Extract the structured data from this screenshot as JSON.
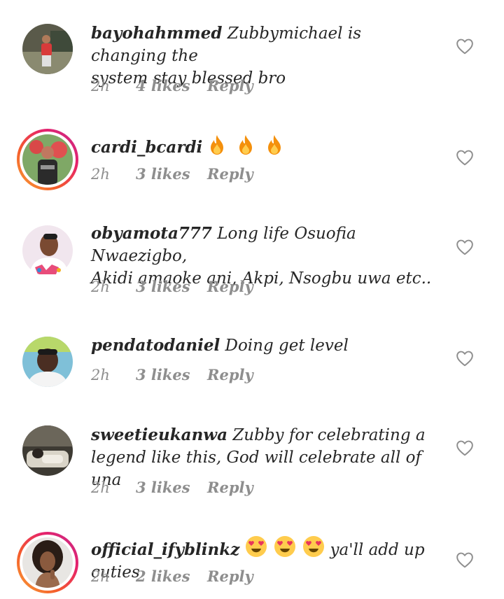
{
  "comments": [
    {
      "username": "bayohahmmed",
      "text": "Zubbymichael is changing the system stay blessed bro",
      "line1": "Zubbymichael is changing the",
      "line2": "system stay blessed bro",
      "time": "2h",
      "likes": "4 likes",
      "reply": "Reply",
      "story_ring": false
    },
    {
      "username": "cardi_bcardi",
      "text": "",
      "emoji": [
        "fire-emoji",
        "fire-emoji",
        "fire-emoji"
      ],
      "time": "2h",
      "likes": "3 likes",
      "reply": "Reply",
      "story_ring": true
    },
    {
      "username": "obyamota777",
      "text": "Long life Osuofia Nwaezigbo, Akidi amaoke ani, Akpi, Nsogbu uwa etc..",
      "line1": "Long life Osuofia Nwaezigbo,",
      "line2": "Akidi amaoke ani, Akpi, Nsogbu uwa etc..",
      "time": "2h",
      "likes": "3 likes",
      "reply": "Reply",
      "story_ring": false
    },
    {
      "username": "pendatodaniel",
      "text": "Doing get level",
      "time": "2h",
      "likes": "3 likes",
      "reply": "Reply",
      "story_ring": false
    },
    {
      "username": "sweetieukanwa",
      "text": "Zubby for celebrating a legend like this, God will celebrate all of una",
      "line1": "Zubby for celebrating a",
      "line2": "legend like this, God will celebrate all of una",
      "time": "2h",
      "likes": "3 likes",
      "reply": "Reply",
      "story_ring": false
    },
    {
      "username": "official_ifyblinkz",
      "text": "ya'll add up cuties",
      "emoji": [
        "heart-eyes-emoji",
        "heart-eyes-emoji",
        "heart-eyes-emoji"
      ],
      "time": "2h",
      "likes": "2 likes",
      "reply": "Reply",
      "story_ring": true
    }
  ],
  "colors": {
    "text": "#262626",
    "meta": "#8e8e8e",
    "story_ring_start": "#f9a236",
    "story_ring_end": "#c42d8a"
  }
}
